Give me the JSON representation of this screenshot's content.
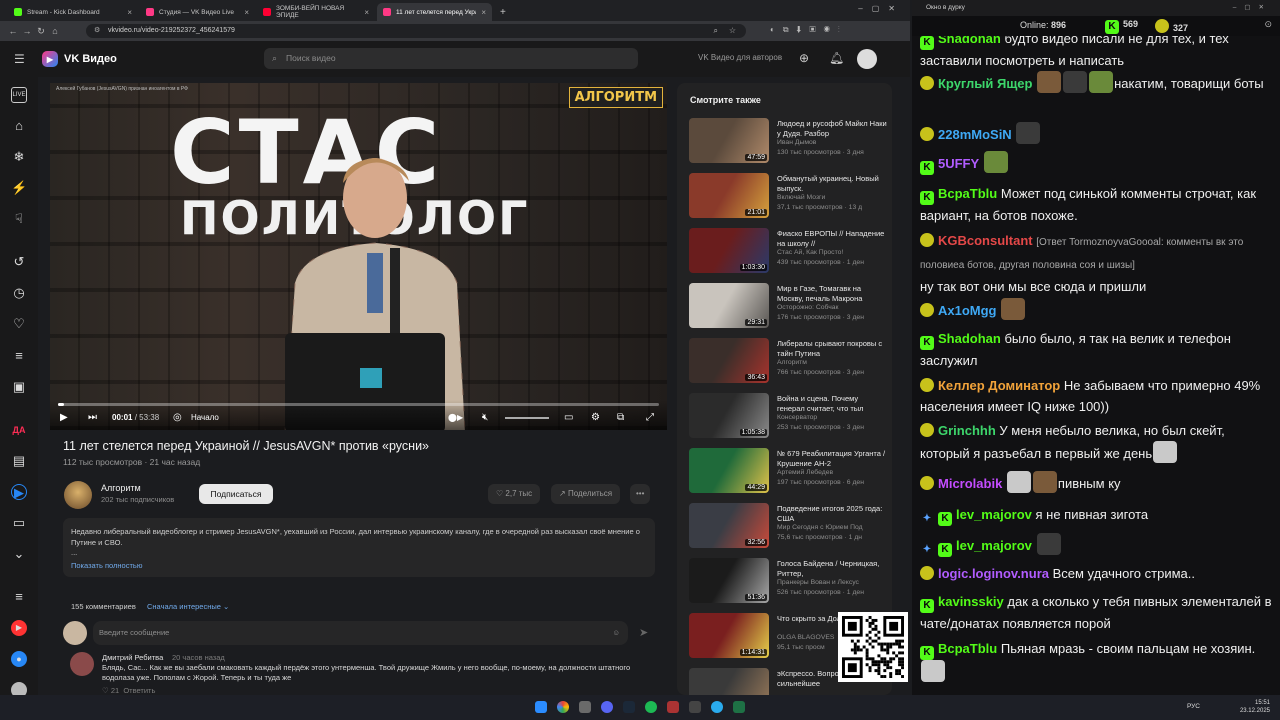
{
  "browser": {
    "tabs": [
      {
        "label": "Stream - Kick Dashboard",
        "color": "#53fc18"
      },
      {
        "label": "Студия — VK Видео Live",
        "color": "#ff3985"
      },
      {
        "label": "ЗОМБИ-ВЕЙП НОВАЯ ЭПИДЕ",
        "color": "#ff0033"
      },
      {
        "label": "11 лет стелется перед Украин",
        "color": "#ff3985"
      }
    ],
    "url": "vkvideo.ru/video-219252372_456241579"
  },
  "vk": {
    "brand": "VK Видео",
    "search_placeholder": "Поиск видео",
    "authors_link": "VK Видео для авторов"
  },
  "player": {
    "overlay_title": "СТАС",
    "overlay_subtitle": "ПОЛИТОЛОГ",
    "channel_logo_text": "АЛГОРИТМ",
    "watermark": "Алексей Губанов (JesusAVGN) признан иноагентом в РФ",
    "current_time": "00:01",
    "duration": "53:38",
    "chapter": "Начало",
    "progress_fraction": 0.01
  },
  "video": {
    "title": "11 лет стелется перед Украиной // JesusAVGN* против «русни»",
    "views": "112 тыс просмотров",
    "age": "21 час назад",
    "channel": "Алгоритм",
    "subscribers": "202 тыс подписчиков",
    "subscribe": "Подписаться",
    "likes": "2,7 тыс",
    "share": "Поделиться",
    "description": "Недавно либеральный видеоблогер и стример JesusAVGN*, уехавший из России, дал интервью украинскому каналу, где в очередной раз высказал своё мнение о Путине и СВО.",
    "description_more": "...",
    "show_more": "Показать полностью"
  },
  "comments": {
    "count": "155 комментариев",
    "sort": "Сначала интересные",
    "input_placeholder": "Введите сообщение",
    "first": {
      "author": "Дмитрий Ребитва",
      "time": "20 часов назад",
      "text": "Блядь, Сас... Как же вы заебали смаковать каждый пердёж этого унтерменша. Твой дружище Жмиль у него вообще, по-моему, на должности штатного водолаза уже. Пополам с Жорой. Теперь и ты туда же",
      "likes": "21",
      "reply": "Ответить"
    }
  },
  "see_also": {
    "heading": "Смотрите также",
    "items": [
      {
        "title": "Людоед и русофоб Майкл Наки у Дудя. Разбор",
        "channel": "Иван Дымов",
        "views": "130 тыс просмотров · 3 дня",
        "duration": "47:59",
        "c1": "#5b4a3c",
        "c2": "#b08a6a"
      },
      {
        "title": "Обманутый украинец. Новый выпуск.",
        "channel": "Включай Мозги",
        "views": "37,1 тыс просмотров · 13 д",
        "duration": "21:01",
        "c1": "#8a3a2a",
        "c2": "#d6a23c"
      },
      {
        "title": "Фиаско ЕВРОПЫ // Нападение на школу //",
        "channel": "Стас Ай, Как Просто!",
        "views": "439 тыс просмотров · 1 ден",
        "duration": "1:03:30",
        "c1": "#6a1d1d",
        "c2": "#2a3a6a"
      },
      {
        "title": "Мир в Газе, Томагавк на Москву, печаль Макрона",
        "channel": "Осторожно: Собчак",
        "views": "176 тыс просмотров · 3 ден",
        "duration": "29:31",
        "c1": "#c9c4bd",
        "c2": "#5a5754"
      },
      {
        "title": "Либералы срывают покровы с тайн Путина",
        "channel": "Алгоритм",
        "views": "766 тыс просмотров · 3 ден",
        "duration": "36:43",
        "c1": "#3a2e2a",
        "c2": "#a8332c"
      },
      {
        "title": "Война и сцена. Почему генерал считает, что тыл",
        "channel": "Консерватор",
        "views": "253 тыс просмотров · 3 ден",
        "duration": "1:05:38",
        "c1": "#2b2b2b",
        "c2": "#8a8a8a"
      },
      {
        "title": "№ 679 Реабилитация Урганта / Крушение АН-2",
        "channel": "Артемий Лебедев",
        "views": "197 тыс просмотров · 6 ден",
        "duration": "44:29",
        "c1": "#1f6a3a",
        "c2": "#e0c24a"
      },
      {
        "title": "Подведение итогов 2025 года: США",
        "channel": "Мир Сегодня с Юрием Под",
        "views": "75,6 тыс просмотров · 1 дн",
        "duration": "32:56",
        "c1": "#3a3d45",
        "c2": "#c94a3a"
      },
      {
        "title": "Голоса Байдена / Черницкая, Риттер,",
        "channel": "Пранкеры Вован и Лексус",
        "views": "526 тыс просмотров · 1 ден",
        "duration": "51:36",
        "c1": "#1b1b1b",
        "c2": "#a8a8a8"
      },
      {
        "title": "Что скрыто за Долиной-Лурье",
        "channel": "OLGA BLAGOVES",
        "views": "95,1 тыс просм",
        "duration": "1:14:31",
        "c1": "#7a1f1f",
        "c2": "#e6d04a"
      },
      {
        "title": "эКспрессо. Вопрос Путина, сильнейшее",
        "channel": "",
        "views": "",
        "duration": "",
        "c1": "#3a3a3a",
        "c2": "#9a7a5a"
      }
    ]
  },
  "chat": {
    "window_title": "Окно в дурку",
    "online_label": "Online:",
    "online": "896",
    "followers": "569",
    "other": "327",
    "messages": [
      {
        "nick": "Shadohan",
        "color": "#53fc18",
        "badges": [
          "kick"
        ],
        "text": "будто видео писали не для тех, и тех заставили посмотреть и написать"
      },
      {
        "nick": "Круглый Ящер",
        "color": "#3dd66b",
        "badges": [
          "frog"
        ],
        "text": "накатим, товарищи боты"
      },
      {
        "nick": "228mMoSiN",
        "color": "#3fa9f5",
        "badges": [
          "frog"
        ],
        "text": ""
      },
      {
        "nick": "5UFFY",
        "color": "#b15cff",
        "badges": [
          "kick"
        ],
        "text": ""
      },
      {
        "nick": "BcpaTblu",
        "color": "#53fc18",
        "badges": [
          "kick"
        ],
        "text": "Может под синькой комменты строчат, как вариант, на ботов похоже."
      },
      {
        "nick": "KGBconsultant",
        "color": "#e44848",
        "badges": [
          "frog"
        ],
        "reply": "[Ответ TormoznoyvaGoooal: комменты вк это половиеа ботов, другая половина соя и шизы]",
        "text": "ну так вот они мы все сюда и пришли"
      },
      {
        "nick": "Ax1oMgg",
        "color": "#3fa9f5",
        "badges": [
          "frog"
        ],
        "text": ""
      },
      {
        "nick": "Shadohan",
        "color": "#53fc18",
        "badges": [
          "kick"
        ],
        "text": "было было, я так на велик и телефон заслужил"
      },
      {
        "nick": "Келлер Доминатор",
        "color": "#f2a33a",
        "badges": [
          "frog"
        ],
        "text": "Не забываем что примерно 49% населения имеет IQ ниже 100))"
      },
      {
        "nick": "Grinchhh",
        "color": "#3dd66b",
        "badges": [
          "frog"
        ],
        "text": "У меня небыло велика, но был скейт, который я разъебал в первый же день"
      },
      {
        "nick": "Microlabik",
        "color": "#c34cff",
        "badges": [
          "frog"
        ],
        "text": "пивным ку"
      },
      {
        "nick": "lev_majorov",
        "color": "#53fc18",
        "badges": [
          "sword",
          "kick"
        ],
        "text": "я не пивная зигота"
      },
      {
        "nick": "lev_majorov",
        "color": "#53fc18",
        "badges": [
          "sword",
          "kick"
        ],
        "text": ""
      },
      {
        "nick": "logic.loginov.nura",
        "color": "#b15cff",
        "badges": [
          "frog"
        ],
        "text": "Всем удачного стрима.."
      },
      {
        "nick": "kavinsskiy",
        "color": "#53fc18",
        "badges": [
          "kick"
        ],
        "text": "дак а сколько у тебя пивных элементалей в чате/донатах появляется порой"
      },
      {
        "nick": "BcpaTblu",
        "color": "#53fc18",
        "badges": [
          "kick"
        ],
        "text": "Пьяная мразь - своим пальцам не хозяин."
      }
    ]
  },
  "taskbar": {
    "lang": "РУС",
    "time": "15:51",
    "date": "23.12.2025"
  }
}
